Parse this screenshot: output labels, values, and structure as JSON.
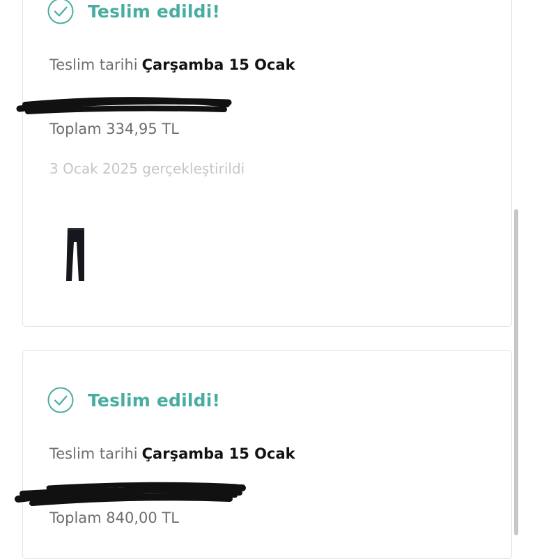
{
  "orders": [
    {
      "status": "Teslim edildi!",
      "delivery_label": "Teslim tarihi",
      "delivery_date": "Çarşamba 15 Ocak",
      "total": "Toplam 334,95 TL",
      "placed": "3 Ocak 2025 gerçekleştirildi",
      "product_icon": "black-leggings"
    },
    {
      "status": "Teslim edildi!",
      "delivery_label": "Teslim tarihi",
      "delivery_date": "Çarşamba 15 Ocak",
      "total": "Toplam 840,00 TL"
    }
  ],
  "colors": {
    "accent": "#48ada0",
    "label": "#6e6e6e",
    "muted": "#c6c6c6",
    "redaction": "#111111"
  }
}
